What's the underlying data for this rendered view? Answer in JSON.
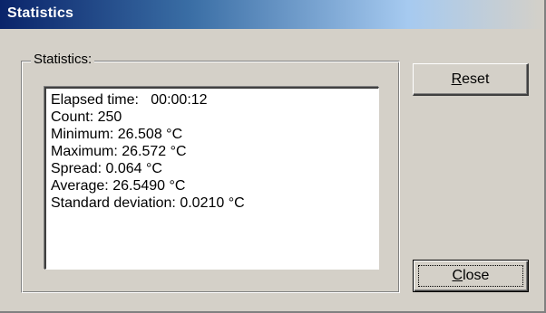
{
  "window": {
    "title": "Statistics"
  },
  "group": {
    "label": "Statistics:"
  },
  "stats": [
    "Elapsed time:   00:00:12",
    "Count: 250",
    "Minimum: 26.508 °C",
    "Maximum: 26.572 °C",
    "Spread: 0.064 °C",
    "Average: 26.5490 °C",
    "Standard deviation: 0.0210 °C"
  ],
  "buttons": {
    "reset": {
      "mnemonic": "R",
      "rest": "eset"
    },
    "close": {
      "mnemonic": "C",
      "rest": "lose"
    }
  },
  "colors": {
    "title_start": "#0a246a",
    "title_end": "#d4d0c8",
    "face": "#d4d0c8"
  }
}
